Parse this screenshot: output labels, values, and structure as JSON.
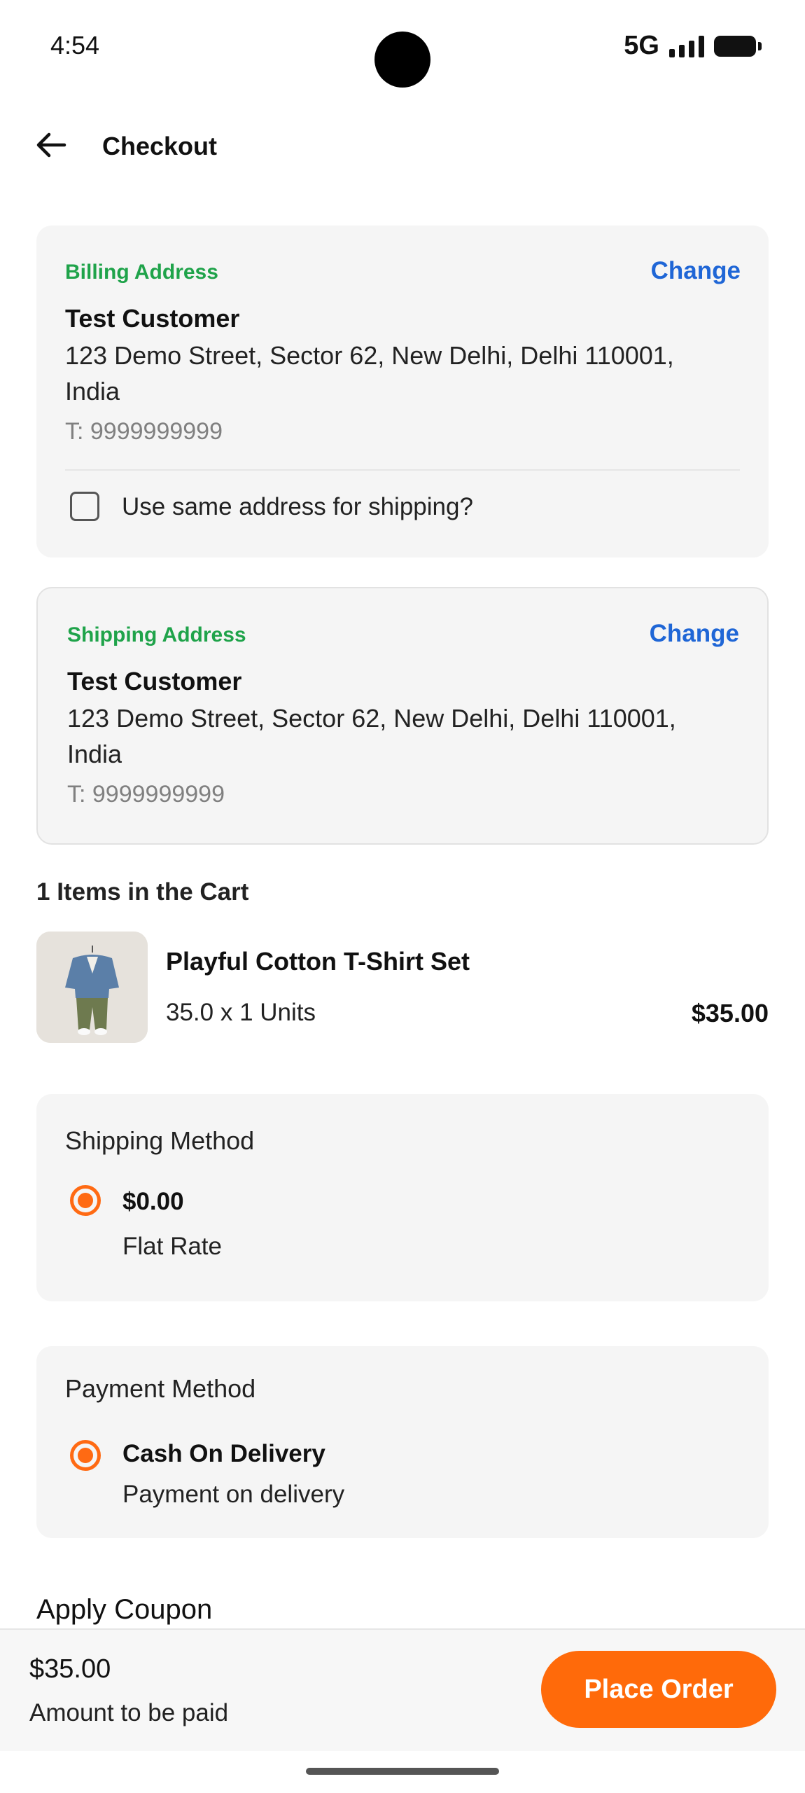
{
  "status_bar": {
    "time": "4:54",
    "network": "5G"
  },
  "header": {
    "title": "Checkout",
    "back_icon": "arrow-left-icon"
  },
  "billing": {
    "label": "Billing Address",
    "change_label": "Change",
    "name": "Test Customer",
    "address_line1": "123 Demo Street, Sector 62, New Delhi, Delhi 110001,",
    "address_line2": "India",
    "phone": "T: 9999999999",
    "same_address_label": "Use same address for shipping?",
    "same_address_checked": false
  },
  "shipping": {
    "label": "Shipping Address",
    "change_label": "Change",
    "name": "Test Customer",
    "address_line1": "123 Demo Street, Sector 62, New Delhi, Delhi 110001,",
    "address_line2": "India",
    "phone": "T: 9999999999"
  },
  "cart": {
    "title": "1 Items in the Cart",
    "items": [
      {
        "name": "Playful Cotton T-Shirt Set",
        "qty_text": "35.0 x 1 Units",
        "price": "$35.00"
      }
    ]
  },
  "shipping_method": {
    "title": "Shipping Method",
    "selected_price": "$0.00",
    "selected_name": "Flat Rate"
  },
  "payment_method": {
    "title": "Payment Method",
    "selected_name": "Cash On Delivery",
    "selected_desc": "Payment on delivery"
  },
  "coupon": {
    "title": "Apply Coupon"
  },
  "footer": {
    "total": "$35.00",
    "total_label": "Amount to be paid",
    "place_order_label": "Place Order"
  },
  "colors": {
    "accent": "#ff6a0a",
    "label_green": "#1fa34a",
    "link_blue": "#1f66d6",
    "card_bg": "#f5f5f5"
  }
}
